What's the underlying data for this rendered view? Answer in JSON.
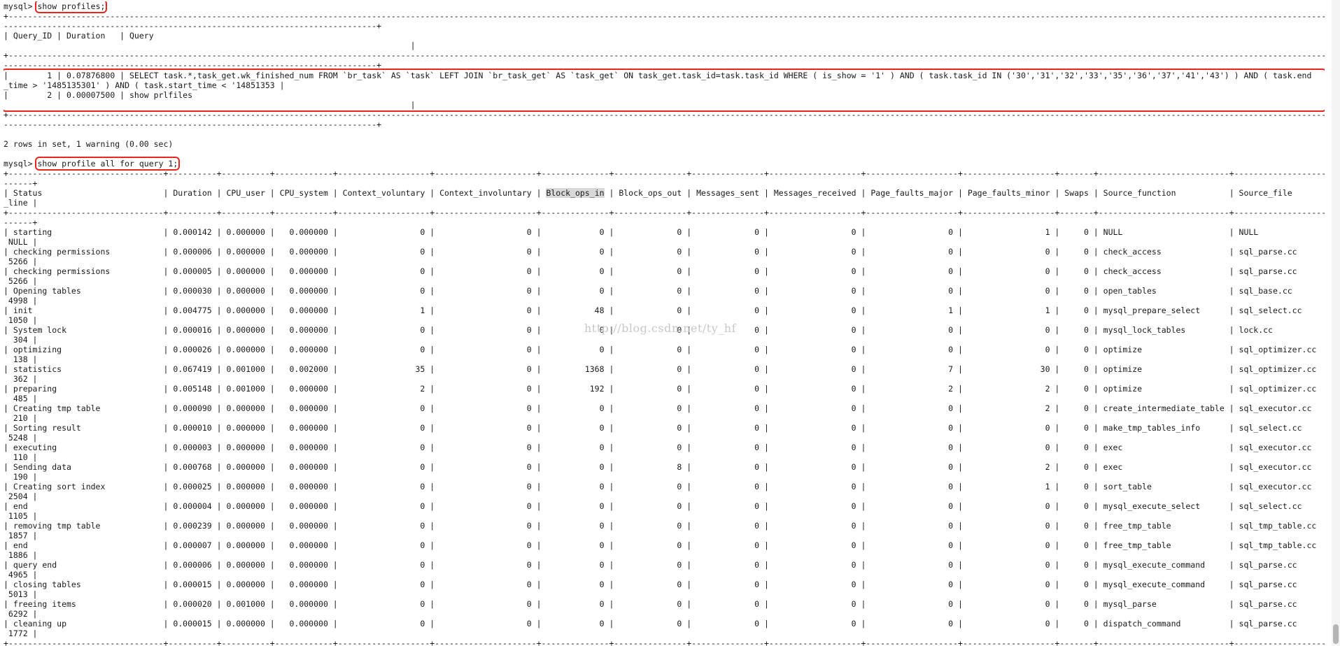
{
  "terminal": {
    "prompt": "mysql>",
    "command1": "show profiles;",
    "profiles_border": "+------------------------------------------------------------------------------------------------------------------------------------------------------------------------------------------------------------------------------------------------------------------------------------------------------------------------------------------------------------------------------------------",
    "profiles_border_cont": "-----------------------------------------------------------------------------+",
    "profiles_header": "| Query_ID | Duration   | Query",
    "profiles_header_cont": "                                                                                    |",
    "profiles_row1": "|        1 | 0.07876800 | SELECT task.*,task_get.wk_finished_num FROM `br_task` AS `task` LEFT JOIN `br_task_get` AS `task_get` ON task_get.task_id=task.task_id WHERE ( is_show = '1' ) AND ( task.task_id IN ('30','31','32','33','35','36','37','41','43') ) AND ( task.end",
    "profiles_row1_cont": "_time > '1485135301' ) AND ( task.start_time < '14851353 |",
    "profiles_row2": "|        2 | 0.00007500 | show prlfiles",
    "profiles_row2_cont": "                                                                                    |",
    "rows_info": "2 rows in set, 1 warning (0.00 sec)",
    "command2": "show profile all for query 1;",
    "profile_border": "+--------------------------------+----------+----------+------------+-------------------+---------------------+--------------+---------------+---------------+-------------------+-------------------+-------------------+-------+---------------------------+-------------------+----------",
    "profile_border_cont": "------+",
    "profile_header": "| Status                         | Duration | CPU_user | CPU_system | Context_voluntary | Context_involuntary | Block_ops_in | Block_ops_out | Messages_sent | Messages_received | Page_faults_major | Page_faults_minor | Swaps | Source_function           | Source_file       | Source",
    "profile_header_cont": "_line |",
    "highlight_word": "Block_ops_in",
    "profile_rows": [
      {
        "text": "| starting                       | 0.000142 | 0.000000 |   0.000000 |                 0 |                   0 |            0 |             0 |             0 |                 0 |                 0 |                 1 |     0 | NULL                      | NULL              |",
        "cont": " NULL |"
      },
      {
        "text": "| checking permissions           | 0.000006 | 0.000000 |   0.000000 |                 0 |                   0 |            0 |             0 |             0 |                 0 |                 0 |                 0 |     0 | check_access              | sql_parse.cc      |",
        "cont": " 5266 |"
      },
      {
        "text": "| checking permissions           | 0.000005 | 0.000000 |   0.000000 |                 0 |                   0 |            0 |             0 |             0 |                 0 |                 0 |                 0 |     0 | check_access              | sql_parse.cc      |",
        "cont": " 5266 |"
      },
      {
        "text": "| Opening tables                 | 0.000030 | 0.000000 |   0.000000 |                 0 |                   0 |            0 |             0 |             0 |                 0 |                 0 |                 0 |     0 | open_tables               | sql_base.cc       |",
        "cont": " 4998 |"
      },
      {
        "text": "| init                           | 0.004775 | 0.000000 |   0.000000 |                 1 |                   0 |           48 |             0 |             0 |                 0 |                 1 |                 1 |     0 | mysql_prepare_select      | sql_select.cc     |",
        "cont": " 1050 |"
      },
      {
        "text": "| System lock                    | 0.000016 | 0.000000 |   0.000000 |                 0 |                   0 |            0 |             0 |             0 |                 0 |                 0 |                 0 |     0 | mysql_lock_tables         | lock.cc           |",
        "cont": "  304 |"
      },
      {
        "text": "| optimizing                     | 0.000026 | 0.000000 |   0.000000 |                 0 |                   0 |            0 |             0 |             0 |                 0 |                 0 |                 0 |     0 | optimize                  | sql_optimizer.cc  |",
        "cont": "  138 |"
      },
      {
        "text": "| statistics                     | 0.067419 | 0.001000 |   0.002000 |                35 |                   0 |         1368 |             0 |             0 |                 0 |                 7 |                30 |     0 | optimize                  | sql_optimizer.cc  |",
        "cont": "  362 |"
      },
      {
        "text": "| preparing                      | 0.005148 | 0.001000 |   0.000000 |                 2 |                   0 |          192 |             0 |             0 |                 0 |                 2 |                 2 |     0 | optimize                  | sql_optimizer.cc  |",
        "cont": "  485 |"
      },
      {
        "text": "| Creating tmp table             | 0.000090 | 0.000000 |   0.000000 |                 0 |                   0 |            0 |             0 |             0 |                 0 |                 0 |                 2 |     0 | create_intermediate_table | sql_executor.cc   |",
        "cont": "  210 |"
      },
      {
        "text": "| Sorting result                 | 0.000010 | 0.000000 |   0.000000 |                 0 |                   0 |            0 |             0 |             0 |                 0 |                 0 |                 0 |     0 | make_tmp_tables_info      | sql_select.cc     |",
        "cont": " 5248 |"
      },
      {
        "text": "| executing                      | 0.000003 | 0.000000 |   0.000000 |                 0 |                   0 |            0 |             0 |             0 |                 0 |                 0 |                 0 |     0 | exec                      | sql_executor.cc   |",
        "cont": "  110 |"
      },
      {
        "text": "| Sending data                   | 0.000768 | 0.000000 |   0.000000 |                 0 |                   0 |            0 |             8 |             0 |                 0 |                 0 |                 2 |     0 | exec                      | sql_executor.cc   |",
        "cont": "  190 |"
      },
      {
        "text": "| Creating sort index            | 0.000025 | 0.000000 |   0.000000 |                 0 |                   0 |            0 |             0 |             0 |                 0 |                 0 |                 1 |     0 | sort_table                | sql_executor.cc   |",
        "cont": " 2504 |"
      },
      {
        "text": "| end                            | 0.000004 | 0.000000 |   0.000000 |                 0 |                   0 |            0 |             0 |             0 |                 0 |                 0 |                 0 |     0 | mysql_execute_select      | sql_select.cc     |",
        "cont": " 1105 |"
      },
      {
        "text": "| removing tmp table             | 0.000239 | 0.000000 |   0.000000 |                 0 |                   0 |            0 |             0 |             0 |                 0 |                 0 |                 0 |     0 | free_tmp_table            | sql_tmp_table.cc  |",
        "cont": " 1857 |"
      },
      {
        "text": "| end                            | 0.000007 | 0.000000 |   0.000000 |                 0 |                   0 |            0 |             0 |             0 |                 0 |                 0 |                 0 |     0 | free_tmp_table            | sql_tmp_table.cc  |",
        "cont": " 1886 |"
      },
      {
        "text": "| query end                      | 0.000006 | 0.000000 |   0.000000 |                 0 |                   0 |            0 |             0 |             0 |                 0 |                 0 |                 0 |     0 | mysql_execute_command     | sql_parse.cc      |",
        "cont": " 4965 |"
      },
      {
        "text": "| closing tables                 | 0.000015 | 0.000000 |   0.000000 |                 0 |                   0 |            0 |             0 |             0 |                 0 |                 0 |                 0 |     0 | mysql_execute_command     | sql_parse.cc      |",
        "cont": " 5013 |"
      },
      {
        "text": "| freeing items                  | 0.000020 | 0.001000 |   0.000000 |                 0 |                   0 |            0 |             0 |             0 |                 0 |                 0 |                 0 |     0 | mysql_parse               | sql_parse.cc      |",
        "cont": " 6292 |"
      },
      {
        "text": "| cleaning up                    | 0.000015 | 0.000000 |   0.000000 |                 0 |                   0 |            0 |             0 |             0 |                 0 |                 0 |                 0 |     0 | dispatch_command          | sql_parse.cc      |",
        "cont": " 1772 |"
      }
    ]
  },
  "watermark": "http://blog.csdn.net/ty_hf",
  "colors": {
    "annotation_box": "#e8261f",
    "background": "#ffffff",
    "text": "#1a1a1a"
  }
}
